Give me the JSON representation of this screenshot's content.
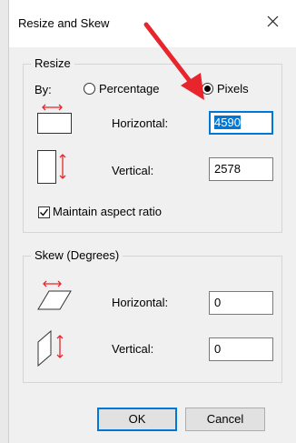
{
  "window": {
    "title": "Resize and Skew",
    "close_symbol": "×"
  },
  "resize": {
    "group_label": "Resize",
    "by_label": "By:",
    "options": [
      {
        "label": "Percentage",
        "checked": false
      },
      {
        "label": "Pixels",
        "checked": true
      }
    ],
    "horizontal_label": "Horizontal:",
    "horizontal_value": "4590",
    "vertical_label": "Vertical:",
    "vertical_value": "2578",
    "maintain_aspect_label": "Maintain aspect ratio",
    "maintain_aspect_checked": true
  },
  "skew": {
    "group_label": "Skew (Degrees)",
    "horizontal_label": "Horizontal:",
    "horizontal_value": "0",
    "vertical_label": "Vertical:",
    "vertical_value": "0"
  },
  "buttons": {
    "ok": "OK",
    "cancel": "Cancel"
  },
  "colors": {
    "accent": "#0078d7",
    "arrow_red": "#e8242c",
    "dialog_bg": "#f0f0f0"
  }
}
